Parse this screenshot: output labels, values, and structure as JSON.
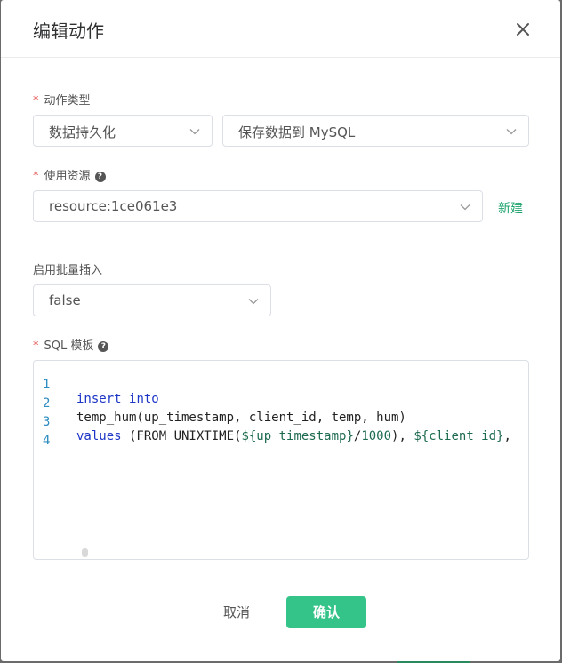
{
  "dialog": {
    "title": "编辑动作",
    "close_icon": "close-icon"
  },
  "form": {
    "action_type": {
      "required_mark": "*",
      "label": "动作类型",
      "category_value": "数据持久化",
      "target_value": "保存数据到 MySQL"
    },
    "resource": {
      "required_mark": "*",
      "label": "使用资源",
      "help": "?",
      "value": "resource:1ce061e3",
      "new_label": "新建"
    },
    "batch": {
      "label": "启用批量插入",
      "value": "false"
    },
    "sql": {
      "required_mark": "*",
      "label": "SQL 模板",
      "help": "?",
      "line_numbers": [
        "1",
        "2",
        "3",
        "4"
      ],
      "line1": {
        "kw1": "insert",
        "sp": " ",
        "kw2": "into"
      },
      "line2": {
        "text": "temp_hum(up_timestamp, client_id, temp, hum)"
      },
      "line3": {
        "kw": "values",
        "t1": " (FROM_UNIXTIME(",
        "v1": "${up_timestamp}",
        "t2": "/",
        "n1": "1000",
        "t3": "), ",
        "v2": "${client_id}",
        "t4": ","
      }
    }
  },
  "footer": {
    "cancel_label": "取消",
    "confirm_label": "确认"
  },
  "colors": {
    "accent": "#34c388",
    "link": "#1ea36d",
    "required": "#e54c4c"
  }
}
